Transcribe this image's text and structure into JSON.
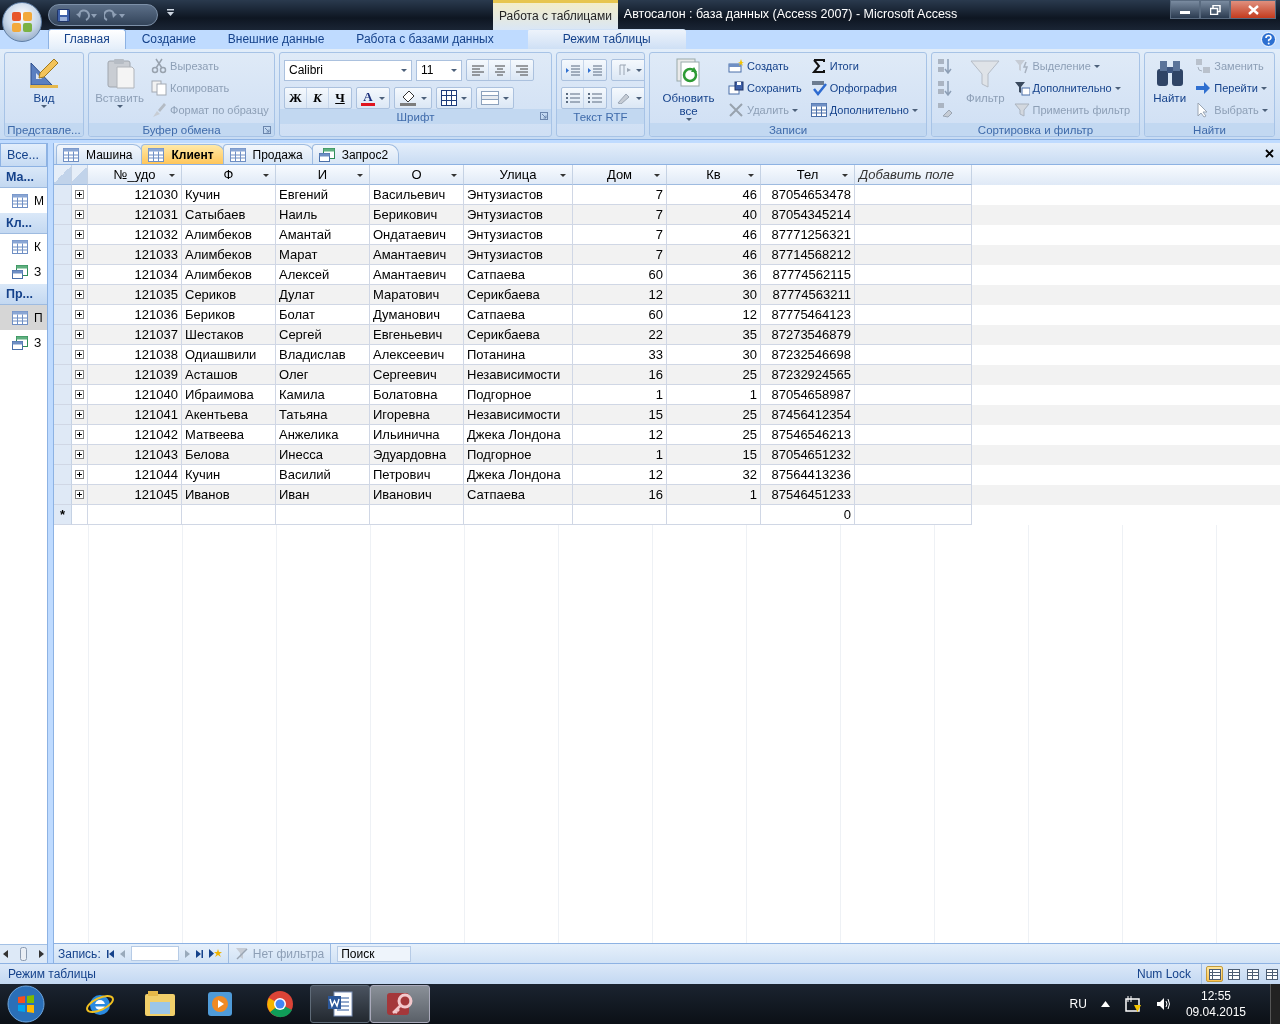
{
  "window": {
    "title": "Автосалон : база данных (Access 2007)  -  Microsoft Access",
    "contextual_tab": "Работа с таблицами"
  },
  "ribbon_tabs": [
    {
      "label": "Главная",
      "selected": true,
      "contextual": false
    },
    {
      "label": "Создание",
      "selected": false,
      "contextual": false
    },
    {
      "label": "Внешние данные",
      "selected": false,
      "contextual": false
    },
    {
      "label": "Работа с базами данных",
      "selected": false,
      "contextual": false
    },
    {
      "label": "Режим таблицы",
      "selected": false,
      "contextual": true
    }
  ],
  "ribbon_groups": [
    {
      "kind": "buttons",
      "label": "Представле...",
      "launcher": false,
      "items": [
        {
          "kind": "large",
          "label": "Вид",
          "dropdown": true,
          "disabled": false
        }
      ]
    },
    {
      "kind": "buttons",
      "label": "Буфер обмена",
      "launcher": true,
      "items": [
        {
          "kind": "large",
          "label": "Вставить",
          "dropdown": true,
          "disabled": true
        },
        {
          "kind": "small",
          "label": "Вырезать",
          "dropdown": false,
          "disabled": true
        },
        {
          "kind": "small",
          "label": "Копировать",
          "dropdown": false,
          "disabled": true
        },
        {
          "kind": "small",
          "label": "Формат по образцу",
          "dropdown": false,
          "disabled": true
        }
      ]
    },
    {
      "kind": "font",
      "label": "Шрифт",
      "launcher": true,
      "font": "Calibri",
      "size": "11",
      "format_buttons": [
        "Ж",
        "К",
        "Ч"
      ],
      "font_color_button": "A"
    },
    {
      "kind": "rtf",
      "label": "Текст RTF",
      "launcher": false
    },
    {
      "kind": "buttons",
      "label": "Записи",
      "launcher": false,
      "items": [
        {
          "kind": "large",
          "label": "Обновить все",
          "dropdown": true,
          "disabled": false
        },
        {
          "kind": "small",
          "label": "Создать",
          "dropdown": false,
          "disabled": false
        },
        {
          "kind": "small",
          "label": "Сохранить",
          "dropdown": false,
          "disabled": false
        },
        {
          "kind": "small",
          "label": "Удалить",
          "dropdown": true,
          "disabled": true
        },
        {
          "kind": "small",
          "label": "Итоги",
          "dropdown": false,
          "disabled": false
        },
        {
          "kind": "small",
          "label": "Орфография",
          "dropdown": false,
          "disabled": false
        },
        {
          "kind": "small",
          "label": "Дополнительно",
          "dropdown": true,
          "disabled": false
        }
      ]
    },
    {
      "kind": "buttons",
      "label": "Сортировка и фильтр",
      "launcher": false,
      "items": [
        {
          "kind": "icon",
          "disabled": true
        },
        {
          "kind": "icon",
          "disabled": true
        },
        {
          "kind": "icon",
          "disabled": true
        },
        {
          "kind": "large",
          "label": "Фильтр",
          "dropdown": false,
          "disabled": true
        },
        {
          "kind": "small",
          "label": "Выделение",
          "dropdown": true,
          "disabled": true
        },
        {
          "kind": "small",
          "label": "Дополнительно",
          "dropdown": true,
          "disabled": false
        },
        {
          "kind": "small",
          "label": "Применить фильтр",
          "dropdown": false,
          "disabled": true
        }
      ]
    },
    {
      "kind": "buttons",
      "label": "Найти",
      "launcher": false,
      "items": [
        {
          "kind": "large",
          "label": "Найти",
          "dropdown": false,
          "disabled": false
        },
        {
          "kind": "small",
          "label": "Заменить",
          "dropdown": false,
          "disabled": true
        },
        {
          "kind": "small",
          "label": "Перейти",
          "dropdown": true,
          "disabled": false
        },
        {
          "kind": "small",
          "label": "Выбрать",
          "dropdown": true,
          "disabled": true
        }
      ]
    }
  ],
  "nav_pane": {
    "header": "Все...",
    "groups": [
      {
        "label": "Ма...",
        "items": [
          {
            "kind": "table",
            "label": "М",
            "selected": false
          }
        ]
      },
      {
        "label": "Кл...",
        "items": [
          {
            "kind": "table",
            "label": "К",
            "selected": false
          },
          {
            "kind": "query",
            "label": "З",
            "selected": false
          }
        ]
      },
      {
        "label": "Пр...",
        "items": [
          {
            "kind": "table",
            "label": "П",
            "selected": true
          },
          {
            "kind": "query",
            "label": "З",
            "selected": false
          }
        ]
      }
    ]
  },
  "document_tabs": [
    {
      "kind": "table",
      "label": "Машина",
      "selected": false
    },
    {
      "kind": "table",
      "label": "Клиент",
      "selected": true
    },
    {
      "kind": "table",
      "label": "Продажа",
      "selected": false
    },
    {
      "kind": "query",
      "label": "Запрос2",
      "selected": false
    }
  ],
  "table": {
    "columns": [
      {
        "label": "№_удо",
        "kind": "number"
      },
      {
        "label": "Ф",
        "kind": "text"
      },
      {
        "label": "И",
        "kind": "text"
      },
      {
        "label": "О",
        "kind": "text"
      },
      {
        "label": "Улица",
        "kind": "text"
      },
      {
        "label": "Дом",
        "kind": "number"
      },
      {
        "label": "Кв",
        "kind": "number"
      },
      {
        "label": "Тел",
        "kind": "number",
        "new_row_default": "0"
      },
      {
        "label": "Добавить поле",
        "kind": "add"
      }
    ],
    "rows": [
      [
        "121030",
        "Кучин",
        "Евгений",
        "Васильевич",
        "Энтузиастов",
        "7",
        "46",
        "87054653478"
      ],
      [
        "121031",
        "Сатыбаев",
        "Наиль",
        "Берикович",
        "Энтузиастов",
        "7",
        "40",
        "87054345214"
      ],
      [
        "121032",
        "Алимбеков",
        "Амантай",
        "Ондатаевич",
        "Энтузиастов",
        "7",
        "46",
        "87771256321"
      ],
      [
        "121033",
        "Алимбеков",
        "Марат",
        "Амантаевич",
        "Энтузиастов",
        "7",
        "46",
        "87714568212"
      ],
      [
        "121034",
        "Алимбеков",
        "Алексей",
        "Амантаевич",
        "Сатпаева",
        "60",
        "36",
        "87774562115"
      ],
      [
        "121035",
        "Сериков",
        "Дулат",
        "Маратович",
        "Серикбаева",
        "12",
        "30",
        "87774563211"
      ],
      [
        "121036",
        "Бериков",
        "Болат",
        "Думанович",
        "Сатпаева",
        "60",
        "12",
        "87775464123"
      ],
      [
        "121037",
        "Шестаков",
        "Сергей",
        "Евгеньевич",
        "Серикбаева",
        "22",
        "35",
        "87273546879"
      ],
      [
        "121038",
        "Одиашвили",
        "Владислав",
        "Алексеевич",
        "Потанина",
        "33",
        "30",
        "87232546698"
      ],
      [
        "121039",
        "Асташов",
        "Олег",
        "Сергеевич",
        "Независимости",
        "16",
        "25",
        "87232924565"
      ],
      [
        "121040",
        "Ибраимова",
        "Камила",
        "Болатовна",
        "Подгорное",
        "1",
        "1",
        "87054658987"
      ],
      [
        "121041",
        "Акентьева",
        "Татьяна",
        "Игоревна",
        "Независимости",
        "15",
        "25",
        "87456412354"
      ],
      [
        "121042",
        "Матвеева",
        "Анжелика",
        "Ильинична",
        "Джека Лондона",
        "12",
        "25",
        "87546546213"
      ],
      [
        "121043",
        "Белова",
        "Инесса",
        "Эдуардовна",
        "Подгорное",
        "1",
        "15",
        "87054651232"
      ],
      [
        "121044",
        "Кучин",
        "Василий",
        "Петрович",
        "Джека Лондона",
        "12",
        "32",
        "87564413236"
      ],
      [
        "121045",
        "Иванов",
        "Иван",
        "Иванович",
        "Сатпаева",
        "16",
        "1",
        "87546451233"
      ]
    ],
    "new_row": {
      "marker": "*"
    }
  },
  "record_navigator": {
    "label": "Запись:",
    "filter": "Нет фильтра",
    "filter_disabled": true,
    "search": {
      "placeholder": "Поиск"
    }
  },
  "status_bar": {
    "mode": "Режим таблицы",
    "indicator": "Num Lock",
    "views": [
      {
        "selected": true
      },
      {
        "selected": false
      },
      {
        "selected": false
      },
      {
        "selected": false
      }
    ]
  },
  "taskbar": {
    "apps": [
      {
        "kind": "ie",
        "open": false
      },
      {
        "kind": "explorer",
        "open": false
      },
      {
        "kind": "media",
        "open": false
      },
      {
        "kind": "chrome",
        "open": false
      },
      {
        "kind": "word",
        "open": true,
        "selected": false
      },
      {
        "kind": "access",
        "open": true,
        "selected": true
      }
    ],
    "language": "RU",
    "time": "12:55",
    "date": "09.04.2015"
  }
}
